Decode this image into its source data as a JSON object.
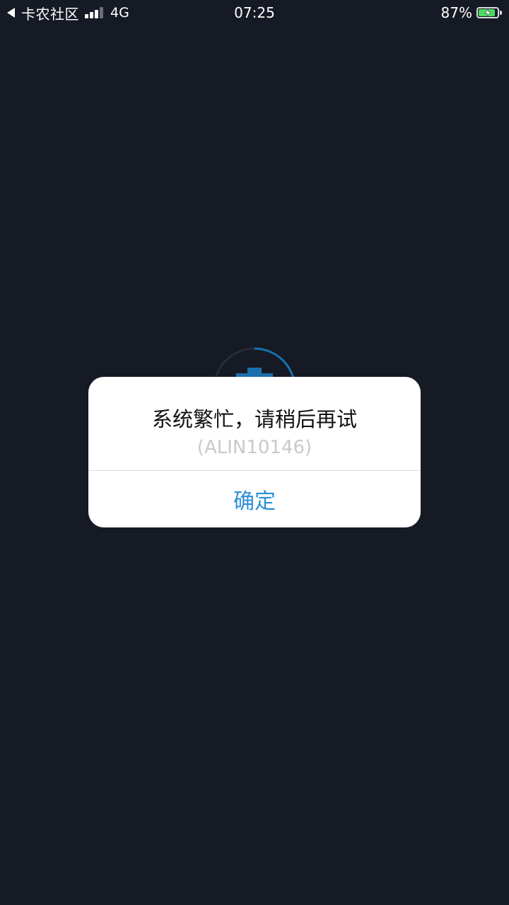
{
  "status_bar": {
    "back_app_label": "卡农社区",
    "network": "4G",
    "time": "07:25",
    "battery_percent": "87%",
    "battery_level": 0.87,
    "battery_charging": true,
    "signal_bars": 3,
    "signal_total": 4
  },
  "alert": {
    "message": "系统繁忙，请稍后再试",
    "code": "(ALIN10146)",
    "confirm_label": "确定"
  },
  "colors": {
    "background": "#161a24",
    "accent": "#2b8fd6",
    "battery": "#4cd964",
    "loader": "#1a6fae"
  },
  "icons": {
    "back": "back-arrow-icon",
    "signal": "cellular-signal-icon",
    "battery": "battery-charging-icon",
    "loader": "loading-spinner-icon"
  }
}
